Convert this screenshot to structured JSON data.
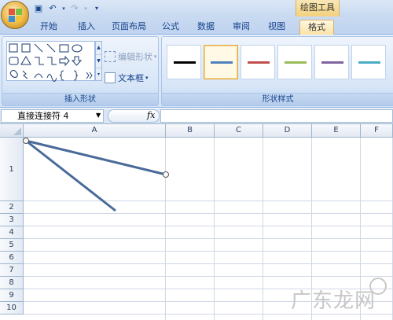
{
  "ribbon_tabs": {
    "context_group": "绘图工具",
    "items": [
      {
        "label": "开始"
      },
      {
        "label": "插入"
      },
      {
        "label": "页面布局"
      },
      {
        "label": "公式"
      },
      {
        "label": "数据"
      },
      {
        "label": "审阅"
      },
      {
        "label": "视图"
      },
      {
        "label": "格式",
        "active": true
      }
    ]
  },
  "quick_access": {
    "save_icon": "save-icon",
    "undo_icon": "undo-icon",
    "redo_icon": "redo-icon",
    "customize_icon": "qat-dropdown-icon"
  },
  "insert_shapes_group": {
    "label": "插入形状",
    "edit_shape_label": "编辑形状",
    "textbox_label": "文本框"
  },
  "shape_styles_group": {
    "label": "形状样式",
    "style_colors": [
      "#000000",
      "#4f81bd",
      "#c0504d",
      "#9bbb59",
      "#8064a2",
      "#4bacc6"
    ],
    "selected_index": 1
  },
  "formula_bar": {
    "name_box": "直接连接符 4",
    "fx_label": "fx",
    "formula": ""
  },
  "sheet": {
    "columns": [
      "A",
      "B",
      "C",
      "D",
      "E",
      "F"
    ],
    "rows": [
      "1",
      "2",
      "3",
      "4",
      "5",
      "6",
      "7",
      "8",
      "9",
      "10"
    ]
  },
  "colors": {
    "ribbon_accent": "#15428b",
    "shape_line": "#4a6a9a",
    "selected_style_border": "#e3a73b"
  },
  "watermark": "广东龙网"
}
